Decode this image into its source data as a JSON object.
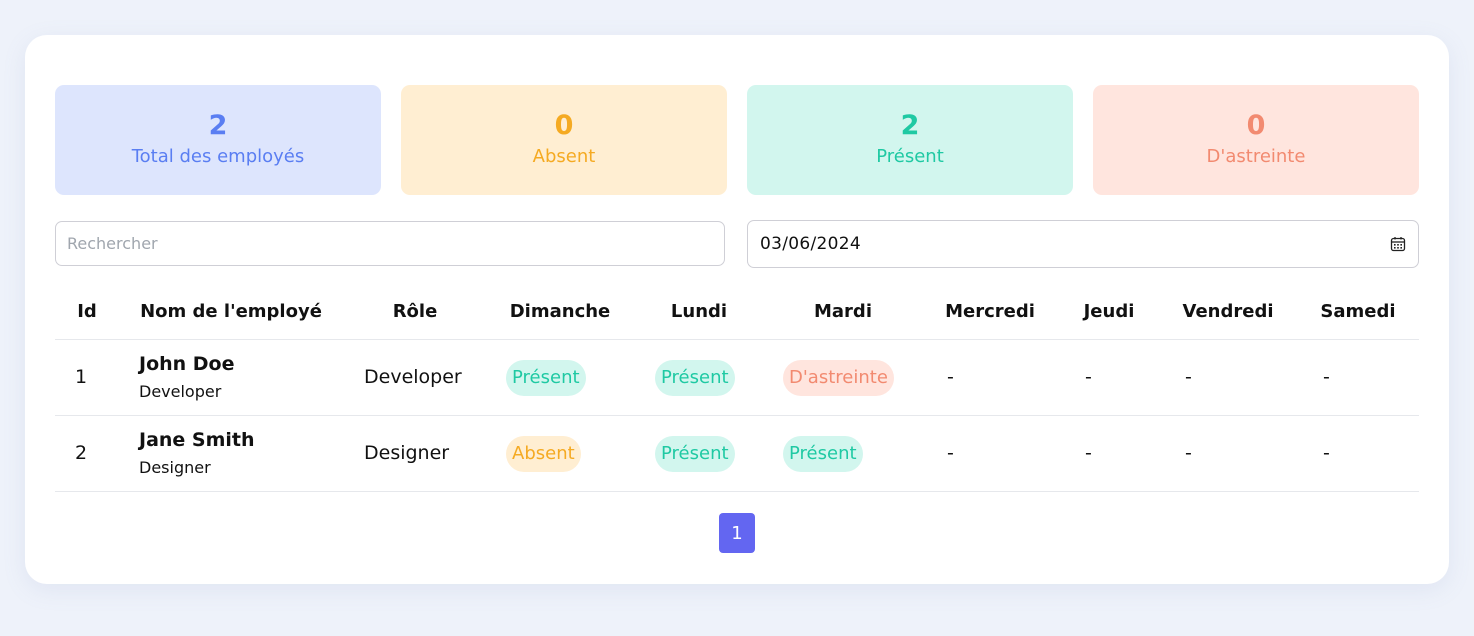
{
  "stats": [
    {
      "value": "2",
      "label": "Total des employés"
    },
    {
      "value": "0",
      "label": "Absent"
    },
    {
      "value": "2",
      "label": "Présent"
    },
    {
      "value": "0",
      "label": "D'astreinte"
    }
  ],
  "search": {
    "placeholder": "Rechercher"
  },
  "date": {
    "value": "03/06/2024",
    "icon": "calendar-icon"
  },
  "table": {
    "headers": [
      "Id",
      "Nom de l'employé",
      "Rôle",
      "Dimanche",
      "Lundi",
      "Mardi",
      "Mercredi",
      "Jeudi",
      "Vendredi",
      "Samedi"
    ],
    "rows": [
      {
        "id": "1",
        "name": "John Doe",
        "subtitle": "Developer",
        "role": "Developer",
        "days": [
          "Présent",
          "Présent",
          "D'astreinte",
          "-",
          "-",
          "-",
          "-"
        ]
      },
      {
        "id": "2",
        "name": "Jane Smith",
        "subtitle": "Designer",
        "role": "Designer",
        "days": [
          "Absent",
          "Présent",
          "Présent",
          "-",
          "-",
          "-",
          "-"
        ]
      }
    ]
  },
  "pagination": {
    "current": "1"
  },
  "colors": {
    "total": "#5a7ef2",
    "absent": "#f5aa22",
    "present": "#1fc9a3",
    "astreinte": "#f28a70",
    "accent": "#6366f1"
  }
}
